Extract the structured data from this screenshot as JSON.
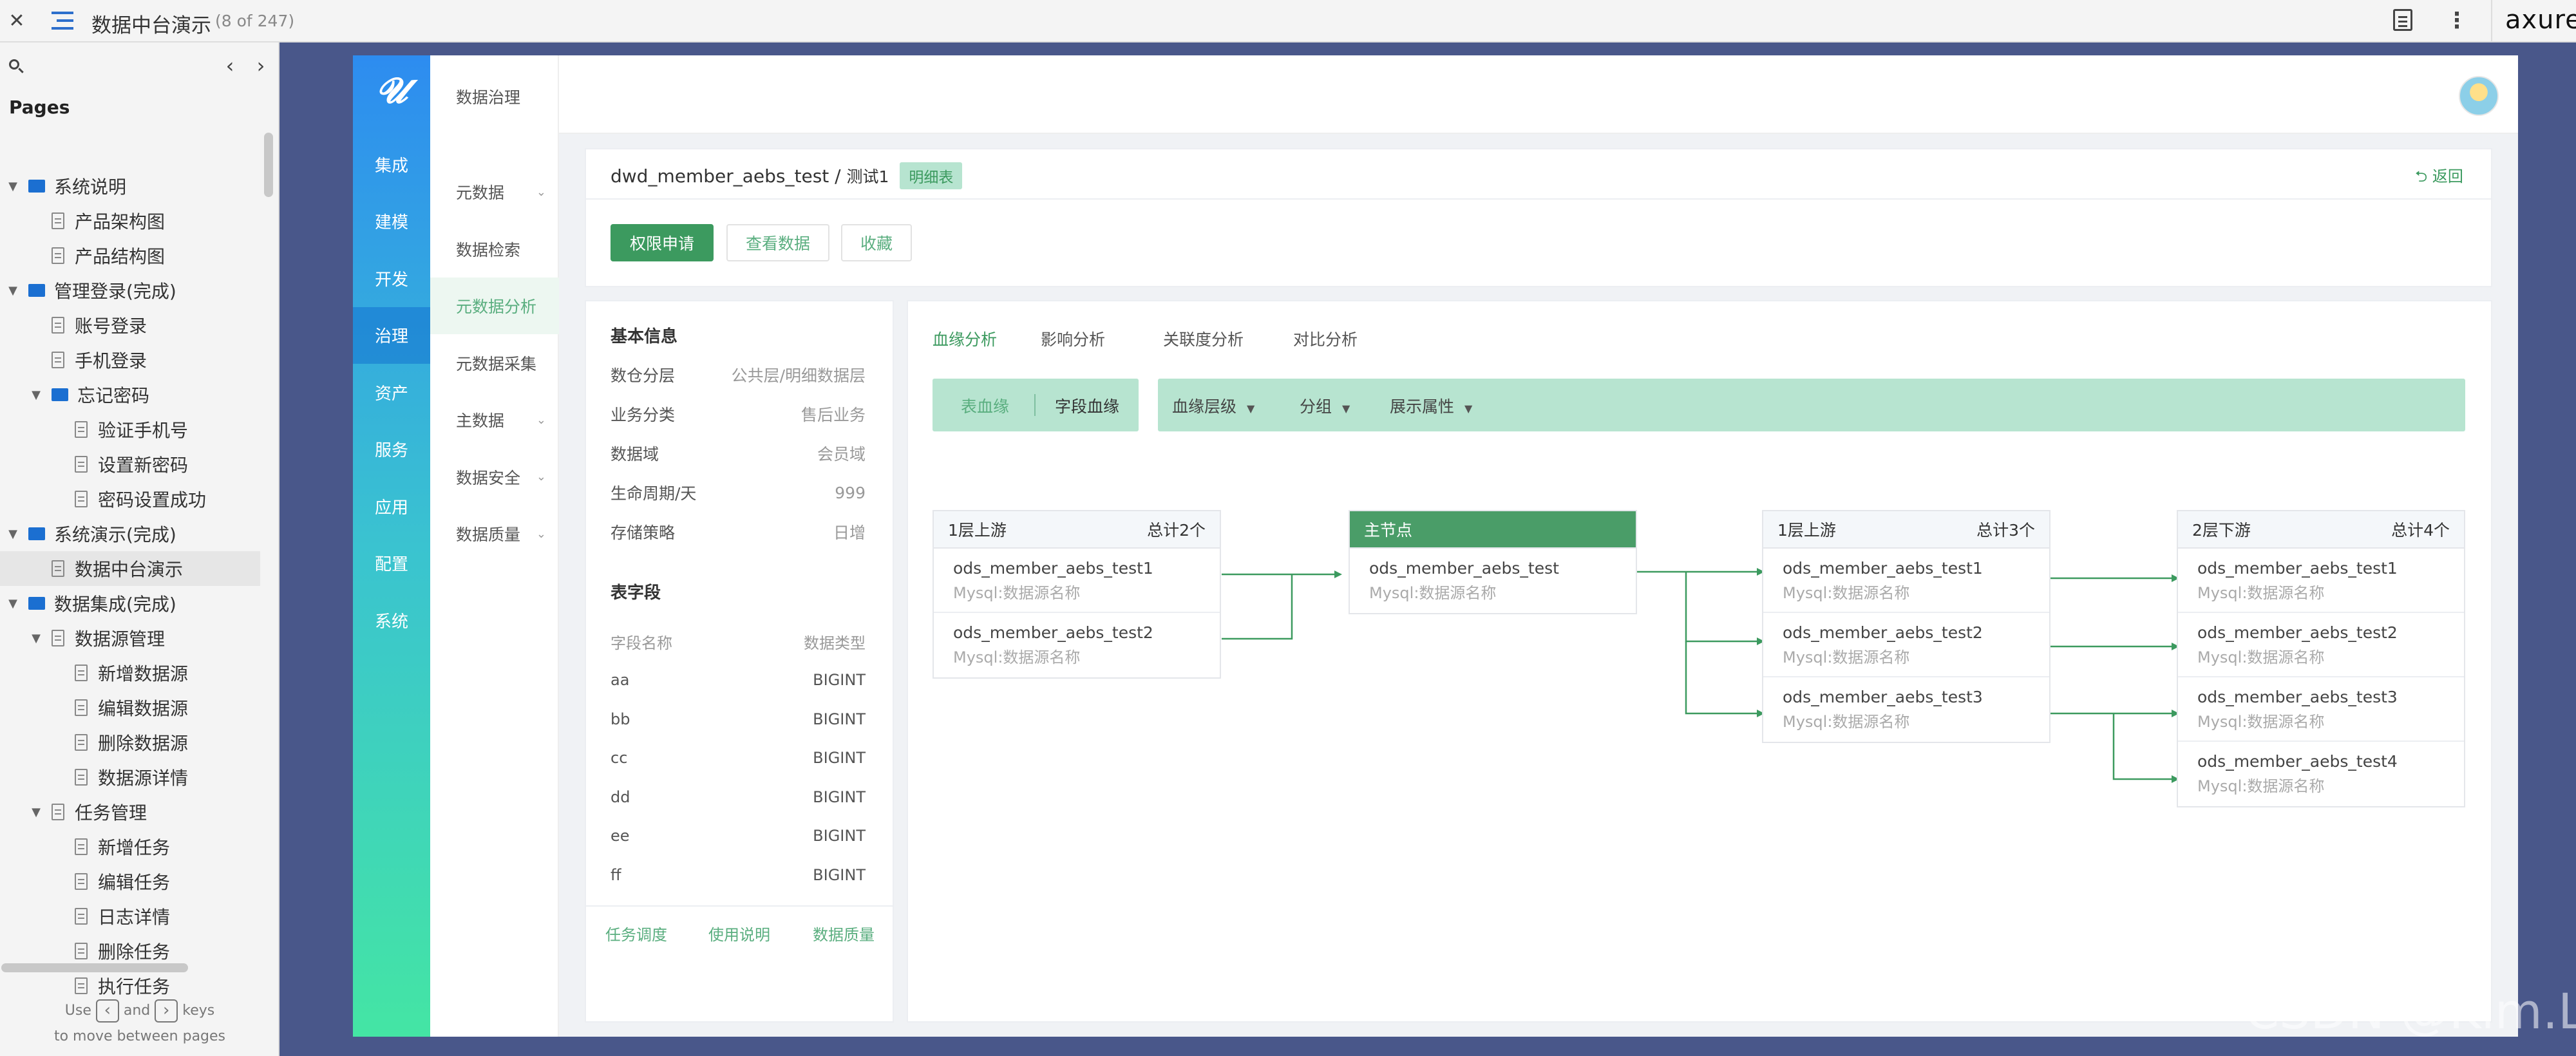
{
  "topbar": {
    "title": "数据中台演示",
    "page_count": "(8 of 247)",
    "brand": "axure"
  },
  "pages_panel": {
    "heading": "Pages",
    "items": [
      {
        "label": "系统说明",
        "type": "folder",
        "level": 0,
        "expanded": true
      },
      {
        "label": "产品架构图",
        "type": "page",
        "level": 1
      },
      {
        "label": "产品结构图",
        "type": "page",
        "level": 1
      },
      {
        "label": "管理登录(完成)",
        "type": "folder",
        "level": 0,
        "expanded": true
      },
      {
        "label": "账号登录",
        "type": "page",
        "level": 1
      },
      {
        "label": "手机登录",
        "type": "page",
        "level": 1
      },
      {
        "label": "忘记密码",
        "type": "folder",
        "level": 1,
        "expanded": true
      },
      {
        "label": "验证手机号",
        "type": "page",
        "level": 2
      },
      {
        "label": "设置新密码",
        "type": "page",
        "level": 2
      },
      {
        "label": "密码设置成功",
        "type": "page",
        "level": 2
      },
      {
        "label": "系统演示(完成)",
        "type": "folder",
        "level": 0,
        "expanded": true
      },
      {
        "label": "数据中台演示",
        "type": "page",
        "level": 1,
        "selected": true
      },
      {
        "label": "数据集成(完成)",
        "type": "folder",
        "level": 0,
        "expanded": true
      },
      {
        "label": "数据源管理",
        "type": "pagegroup",
        "level": 1,
        "expanded": true
      },
      {
        "label": "新增数据源",
        "type": "page",
        "level": 2
      },
      {
        "label": "编辑数据源",
        "type": "page",
        "level": 2
      },
      {
        "label": "删除数据源",
        "type": "page",
        "level": 2
      },
      {
        "label": "数据源详情",
        "type": "page",
        "level": 2
      },
      {
        "label": "任务管理",
        "type": "pagegroup",
        "level": 1,
        "expanded": true
      },
      {
        "label": "新增任务",
        "type": "page",
        "level": 2
      },
      {
        "label": "编辑任务",
        "type": "page",
        "level": 2
      },
      {
        "label": "日志详情",
        "type": "page",
        "level": 2
      },
      {
        "label": "删除任务",
        "type": "page",
        "level": 2
      },
      {
        "label": "执行任务",
        "type": "page",
        "level": 2
      }
    ],
    "hint_use": "Use",
    "hint_and": "and",
    "hint_keys": "keys",
    "hint_line2": "to move between pages"
  },
  "rail": {
    "items": [
      "集成",
      "建模",
      "开发",
      "治理",
      "资产",
      "服务",
      "应用",
      "配置",
      "系统"
    ],
    "active": "治理"
  },
  "subnav": {
    "header": "数据治理",
    "items": [
      {
        "label": "元数据",
        "chevron": true
      },
      {
        "label": "数据检索",
        "chevron": false
      },
      {
        "label": "元数据分析",
        "chevron": false,
        "active": true
      },
      {
        "label": "元数据采集",
        "chevron": false
      },
      {
        "label": "主数据",
        "chevron": true
      },
      {
        "label": "数据安全",
        "chevron": true
      },
      {
        "label": "数据质量",
        "chevron": true
      }
    ]
  },
  "detail": {
    "table_name": "dwd_member_aebs_test",
    "separator": "/",
    "table_desc": "测试1",
    "tag": "明细表",
    "back": "返回",
    "buttons": {
      "apply": "权限申请",
      "view": "查看数据",
      "favorite": "收藏"
    }
  },
  "basic_info": {
    "title": "基本信息",
    "rows": [
      {
        "key": "数仓分层",
        "value": "公共层/明细数据层"
      },
      {
        "key": "业务分类",
        "value": "售后业务"
      },
      {
        "key": "数据域",
        "value": "会员域"
      },
      {
        "key": "生命周期/天",
        "value": "999"
      },
      {
        "key": "存储策略",
        "value": "日增"
      }
    ],
    "fields_title": "表字段",
    "fields_header": {
      "name": "字段名称",
      "type": "数据类型"
    },
    "fields": [
      {
        "name": "aa",
        "type": "BIGINT"
      },
      {
        "name": "bb",
        "type": "BIGINT"
      },
      {
        "name": "cc",
        "type": "BIGINT"
      },
      {
        "name": "dd",
        "type": "BIGINT"
      },
      {
        "name": "ee",
        "type": "BIGINT"
      },
      {
        "name": "ff",
        "type": "BIGINT"
      }
    ],
    "footer_links": [
      "任务调度",
      "使用说明",
      "数据质量"
    ]
  },
  "analysis": {
    "tabs": [
      "血缘分析",
      "影响分析",
      "关联度分析",
      "对比分析"
    ],
    "active_tab": "血缘分析",
    "toggle": {
      "table": "表血缘",
      "field": "字段血缘",
      "active": "表血缘"
    },
    "filters": [
      "血缘层级",
      "分组",
      "展示属性"
    ],
    "lineage": {
      "upstream1": {
        "title": "1层上游",
        "total": "总计2个",
        "rows": [
          {
            "name": "ods_member_aebs_test1",
            "source": "Mysql:数据源名称"
          },
          {
            "name": "ods_member_aebs_test2",
            "source": "Mysql:数据源名称"
          }
        ]
      },
      "main": {
        "title": "主节点",
        "rows": [
          {
            "name": "ods_member_aebs_test",
            "source": "Mysql:数据源名称"
          }
        ]
      },
      "downstream1": {
        "title": "1层上游",
        "total": "总计3个",
        "rows": [
          {
            "name": "ods_member_aebs_test1",
            "source": "Mysql:数据源名称"
          },
          {
            "name": "ods_member_aebs_test2",
            "source": "Mysql:数据源名称"
          },
          {
            "name": "ods_member_aebs_test3",
            "source": "Mysql:数据源名称"
          }
        ]
      },
      "downstream2": {
        "title": "2层下游",
        "total": "总计4个",
        "rows": [
          {
            "name": "ods_member_aebs_test1",
            "source": "Mysql:数据源名称"
          },
          {
            "name": "ods_member_aebs_test2",
            "source": "Mysql:数据源名称"
          },
          {
            "name": "ods_member_aebs_test3",
            "source": "Mysql:数据源名称"
          },
          {
            "name": "ods_member_aebs_test4",
            "source": "Mysql:数据源名称"
          }
        ]
      }
    }
  },
  "watermark": "CSDN @Kim.Li",
  "colors": {
    "accent": "#3c9a5f",
    "rail_top": "#2d8cf0",
    "rail_bottom": "#44e5a4",
    "frame_bg": "#49578a"
  }
}
